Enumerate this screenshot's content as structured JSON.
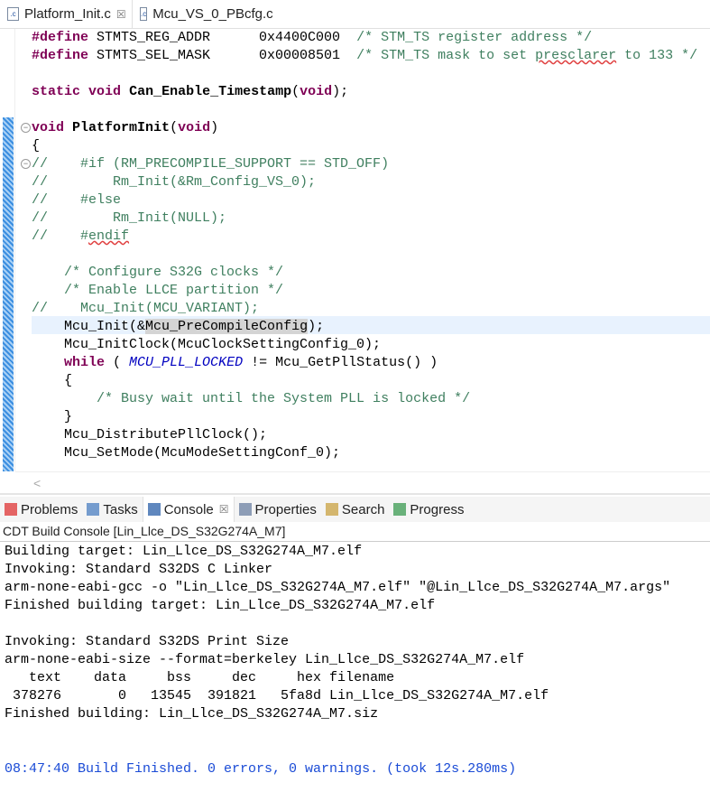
{
  "tabs": [
    {
      "label": "Platform_Init.c",
      "active": true
    },
    {
      "label": "Mcu_VS_0_PBcfg.c",
      "active": false
    }
  ],
  "code": [
    [
      [
        "#define",
        "kw"
      ],
      [
        " STMTS_REG_ADDR      0x4400C000  ",
        ""
      ],
      [
        "/* STM_TS register address */",
        "cm"
      ]
    ],
    [
      [
        "#define",
        "kw"
      ],
      [
        " STMTS_SEL_MASK      0x00008501  ",
        ""
      ],
      [
        "/* STM_TS mask to set ",
        "cm"
      ],
      [
        "presclarer",
        "cm sq"
      ],
      [
        " to 133 */",
        "cm"
      ]
    ],
    [],
    [
      [
        "static",
        "kw"
      ],
      [
        " ",
        ""
      ],
      [
        "void",
        "kw"
      ],
      [
        " ",
        ""
      ],
      [
        "Can_Enable_Timestamp",
        "fn"
      ],
      [
        "(",
        ""
      ],
      [
        "void",
        "kw"
      ],
      [
        ");",
        ""
      ]
    ],
    [],
    [
      [
        "void",
        "kw"
      ],
      [
        " ",
        ""
      ],
      [
        "PlatformInit",
        "fn"
      ],
      [
        "(",
        ""
      ],
      [
        "void",
        "kw"
      ],
      [
        ")",
        ""
      ]
    ],
    [
      [
        "{",
        ""
      ]
    ],
    [
      [
        "//    #if (RM_PRECOMPILE_SUPPORT == STD_OFF)",
        "cm"
      ]
    ],
    [
      [
        "//        Rm_Init(&Rm_Config_VS_0);",
        "cm"
      ]
    ],
    [
      [
        "//    #else",
        "cm"
      ]
    ],
    [
      [
        "//        Rm_Init(NULL);",
        "cm"
      ]
    ],
    [
      [
        "//    #",
        "cm"
      ],
      [
        "endif",
        "cm sq"
      ]
    ],
    [],
    [
      [
        "    /* Configure S32G clocks */",
        "cm"
      ]
    ],
    [
      [
        "    /* Enable LLCE partition */",
        "cm"
      ]
    ],
    [
      [
        "//    Mcu_Init(MCU_VARIANT);",
        "cm"
      ]
    ],
    [
      [
        "    Mcu_Init(&",
        ""
      ],
      [
        "Mcu_P",
        "occ"
      ],
      [
        "|caret",
        ""
      ],
      [
        "reCompileConfig",
        "occ"
      ],
      [
        ");",
        ""
      ]
    ],
    [
      [
        "    Mcu_InitClock(McuClockSettingConfig_0);",
        ""
      ]
    ],
    [
      [
        "    ",
        ""
      ],
      [
        "while",
        "kw"
      ],
      [
        " ( ",
        ""
      ],
      [
        "MCU_PLL_LOCKED",
        "mc"
      ],
      [
        " != Mcu_GetPllStatus() )",
        ""
      ]
    ],
    [
      [
        "    {",
        ""
      ]
    ],
    [
      [
        "        /* Busy wait until the System PLL is locked */",
        "cm"
      ]
    ],
    [
      [
        "    }",
        ""
      ]
    ],
    [
      [
        "    Mcu_DistributePllClock();",
        ""
      ]
    ],
    [
      [
        "    Mcu_SetMode(McuModeSettingConf_0);",
        ""
      ]
    ]
  ],
  "views": [
    {
      "label": "Problems",
      "icon": "problems-icon"
    },
    {
      "label": "Tasks",
      "icon": "tasks-icon"
    },
    {
      "label": "Console",
      "icon": "console-icon",
      "active": true
    },
    {
      "label": "Properties",
      "icon": "properties-icon"
    },
    {
      "label": "Search",
      "icon": "search-icon"
    },
    {
      "label": "Progress",
      "icon": "progress-icon"
    }
  ],
  "console": {
    "title": "CDT Build Console [Lin_Llce_DS_S32G274A_M7]",
    "lines": [
      "Building target: Lin_Llce_DS_S32G274A_M7.elf",
      "Invoking: Standard S32DS C Linker",
      "arm-none-eabi-gcc -o \"Lin_Llce_DS_S32G274A_M7.elf\" \"@Lin_Llce_DS_S32G274A_M7.args\"",
      "Finished building target: Lin_Llce_DS_S32G274A_M7.elf",
      "",
      "Invoking: Standard S32DS Print Size",
      "arm-none-eabi-size --format=berkeley Lin_Llce_DS_S32G274A_M7.elf",
      "   text    data     bss     dec     hex filename",
      " 378276       0   13545  391821   5fa8d Lin_Llce_DS_S32G274A_M7.elf",
      "Finished building: Lin_Llce_DS_S32G274A_M7.siz",
      "",
      "",
      "",
      ""
    ],
    "finished": "08:47:40 Build Finished. 0 errors, 0 warnings. (took 12s.280ms)"
  }
}
